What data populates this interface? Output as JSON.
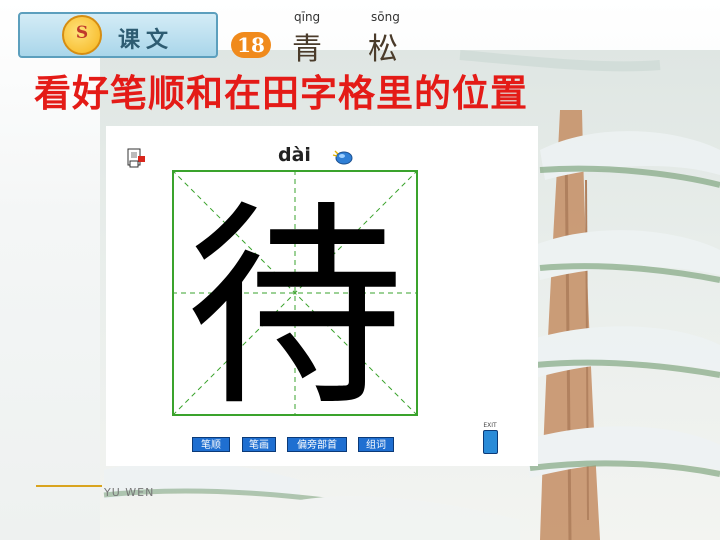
{
  "header": {
    "lesson_category": "课文",
    "lesson_number": "18",
    "title_chars": [
      {
        "pinyin": "qīng",
        "hanzi": "青"
      },
      {
        "pinyin": "sōng",
        "hanzi": "松"
      }
    ]
  },
  "instruction": "看好笔顺和在田字格里的位置",
  "writer": {
    "pinyin": "dài",
    "character": "待",
    "buttons": [
      "笔顺",
      "笔画",
      "偏旁部首",
      "组词"
    ],
    "exit_label": "EXIT"
  },
  "footer": {
    "text": "YU WEN"
  },
  "colors": {
    "instruction": "#e41b17",
    "grid_line": "#3aa32c",
    "button_blue": "#1f6fd1",
    "lesson_badge": "#f08a1c"
  }
}
